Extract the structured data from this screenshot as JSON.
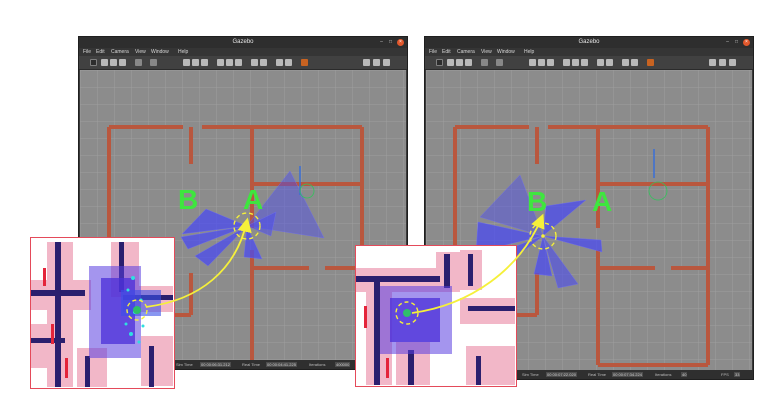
{
  "left_window": {
    "title": "Gazebo",
    "menu": [
      "File",
      "Edit",
      "Camera",
      "View",
      "Window",
      "Help"
    ],
    "status": {
      "sim_time_label": "Sim Time",
      "sim_time_value": "00 00:06:31.212",
      "real_time_label": "Real Time",
      "real_time_value": "00 00:04:41.225",
      "iterations_label": "Iterations",
      "iterations_value": "400000"
    },
    "labels": {
      "a": "A",
      "b": "B"
    }
  },
  "right_window": {
    "title": "Gazebo",
    "menu": [
      "File",
      "Edit",
      "Camera",
      "View",
      "Window",
      "Help"
    ],
    "status": {
      "sim_time_label": "Sim Time",
      "sim_time_value": "00 00:07:22.020",
      "real_time_label": "Real Time",
      "real_time_value": "00 00:07:34.224",
      "iterations_label": "Iterations",
      "iterations_value": "40",
      "fps_label": "FPS",
      "fps_value": "33"
    },
    "labels": {
      "a": "A",
      "b": "B"
    }
  },
  "window_controls": [
    "–",
    "□",
    "×"
  ],
  "colors": {
    "label_green": "#3ee63e",
    "arrow_yellow": "#f5f03a",
    "wall_brick": "#b9573e",
    "laser_blue": "#4b4bf0",
    "inset_border": "#e44a5a",
    "close_button": "#e2572b"
  }
}
